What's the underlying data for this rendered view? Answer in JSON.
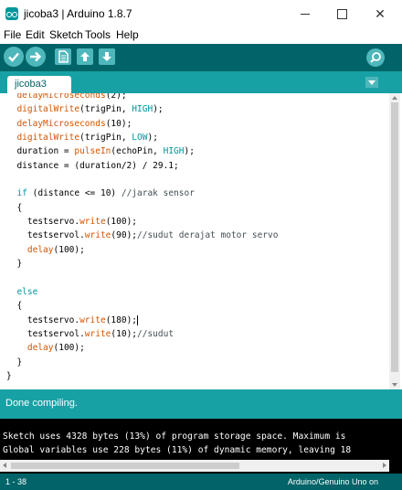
{
  "window": {
    "title": "jicoba3 | Arduino 1.8.7",
    "minimize": "—",
    "maximize": "☐",
    "close": "✕"
  },
  "menu": [
    "File",
    "Edit",
    "Sketch",
    "Tools",
    "Help"
  ],
  "toolbar": {
    "buttons": [
      "verify-icon",
      "upload-icon",
      "new-icon",
      "open-icon",
      "save-icon"
    ],
    "serial_monitor": "magnifier-icon"
  },
  "tabs": [
    {
      "label": "jicoba3"
    }
  ],
  "editor": {
    "lines": [
      "  delayMicroseconds(2);",
      "  digitalWrite(trigPin, HIGH);",
      "  delayMicroseconds(10);",
      "  digitalWrite(trigPin, LOW);",
      "  duration = pulseIn(echoPin, HIGH);",
      "  distance = (duration/2) / 29.1;",
      "",
      "  if (distance <= 10) //jarak sensor",
      "  {",
      "    testservo.write(100);",
      "    testservol.write(90);//sudut derajat motor servo",
      "    delay(100);",
      "  }",
      "",
      "  else",
      "  {",
      "    testservo.write(180);",
      "    testservol.write(10);//sudut",
      "    delay(100);",
      "  }",
      "}"
    ]
  },
  "status": {
    "message": "Done compiling."
  },
  "console": {
    "lines": [
      "Sketch uses 4328 bytes (13%) of program storage space. Maximum is",
      "Global variables use 228 bytes (11%) of dynamic memory, leaving 18"
    ]
  },
  "footer": {
    "line": "1 - 38",
    "board": "Arduino/Genuino Uno on"
  },
  "colors": {
    "toolbar": "#006468",
    "tab_row": "#17a1a5",
    "keyword": "#00979c",
    "function": "#d35400"
  }
}
